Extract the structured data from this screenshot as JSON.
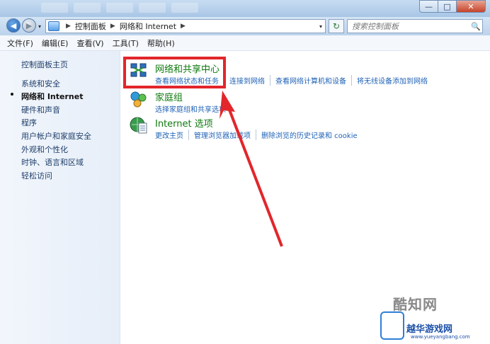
{
  "window": {
    "min_label": "—",
    "max_label": "□",
    "close_label": "✕"
  },
  "navigation": {
    "back_glyph": "◀",
    "forward_glyph": "▶",
    "dropdown_glyph": "▾",
    "breadcrumb": [
      "控制面板",
      "网络和 Internet"
    ],
    "separator": "▶",
    "end_dropdown": "▾",
    "refresh_glyph": "↻",
    "search_placeholder": "搜索控制面板",
    "search_glyph": "🔍"
  },
  "menu": [
    "文件(F)",
    "编辑(E)",
    "查看(V)",
    "工具(T)",
    "帮助(H)"
  ],
  "sidebar": {
    "items": [
      {
        "label": "控制面板主页",
        "current": false
      },
      {
        "label": "系统和安全",
        "current": false
      },
      {
        "label": "网络和 Internet",
        "current": true
      },
      {
        "label": "硬件和声音",
        "current": false
      },
      {
        "label": "程序",
        "current": false
      },
      {
        "label": "用户帐户和家庭安全",
        "current": false
      },
      {
        "label": "外观和个性化",
        "current": false
      },
      {
        "label": "时钟、语言和区域",
        "current": false
      },
      {
        "label": "轻松访问",
        "current": false
      }
    ]
  },
  "categories": [
    {
      "title": "网络和共享中心",
      "icon": "network-sharing-icon",
      "links": [
        "查看网络状态和任务",
        "连接到网络",
        "查看网络计算机和设备",
        "将无线设备添加到网络"
      ]
    },
    {
      "title": "家庭组",
      "icon": "homegroup-icon",
      "links": [
        "选择家庭组和共享选项"
      ]
    },
    {
      "title": "Internet 选项",
      "icon": "internet-options-icon",
      "links": [
        "更改主页",
        "管理浏览器加载项",
        "删除浏览的历史记录和 cookie"
      ]
    }
  ],
  "colors": {
    "highlight": "#e2262b",
    "category_title": "#0e7a0e",
    "link": "#1f62b6"
  },
  "watermark": {
    "line1": "酷知网",
    "line2": "越华游戏网",
    "line3": "www.yueyangbang.com"
  }
}
